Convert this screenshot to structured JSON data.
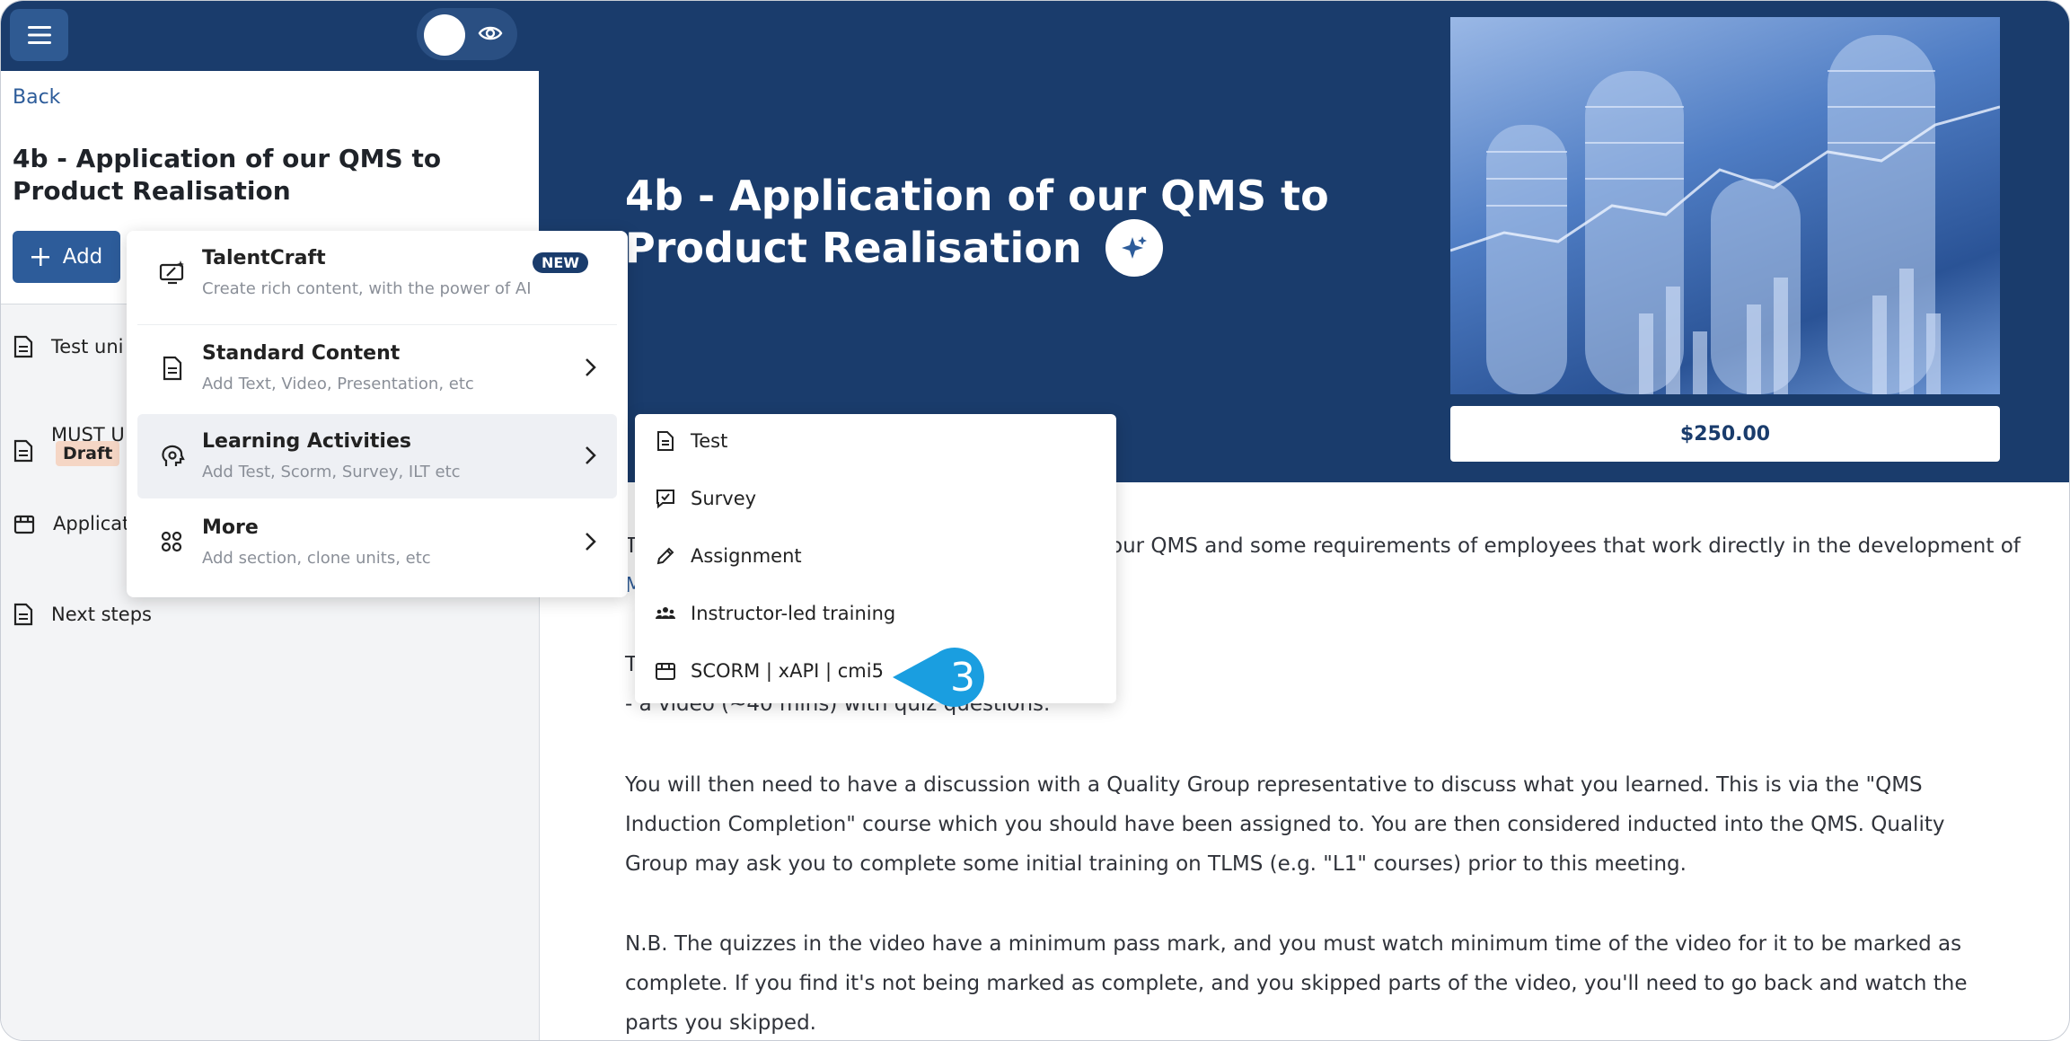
{
  "sidebar": {
    "back_label": "Back",
    "course_title": "4b - Application of our QMS to Product Realisation",
    "add_label": "Add",
    "units": [
      {
        "label": "Test uni",
        "icon": "document-icon"
      },
      {
        "label": "MUST U",
        "icon": "document-icon",
        "badge": "Draft"
      },
      {
        "label": "Applicat",
        "icon": "package-icon"
      },
      {
        "label": "Next steps",
        "icon": "document-icon"
      }
    ]
  },
  "add_menu": {
    "items": [
      {
        "title": "TalentCraft",
        "subtitle": "Create rich content, with the power of AI",
        "badge": "NEW",
        "icon": "ai-monitor-icon"
      },
      {
        "title": "Standard Content",
        "subtitle": "Add Text, Video, Presentation, etc",
        "icon": "document-icon"
      },
      {
        "title": "Learning Activities",
        "subtitle": "Add Test, Scorm, Survey, ILT etc",
        "icon": "brain-gear-icon"
      },
      {
        "title": "More",
        "subtitle": "Add section, clone units, etc",
        "icon": "grid-icon"
      }
    ]
  },
  "activity_menu": {
    "items": [
      {
        "label": "Test",
        "icon": "document-icon"
      },
      {
        "label": "Survey",
        "icon": "survey-icon"
      },
      {
        "label": "Assignment",
        "icon": "pencil-icon"
      },
      {
        "label": "Instructor-led training",
        "icon": "group-icon"
      },
      {
        "label": "SCORM | xAPI | cmi5",
        "icon": "package-icon"
      }
    ]
  },
  "main": {
    "hero_title": "4b - Application of our QMS to Product Realisation",
    "price": "$250.00",
    "para1_left": "T",
    "para1_right": "our QMS and some requirements of employees that work directly in the development of",
    "para1_line2_start": "M",
    "para2_start": "T",
    "para2_line2": "- a video (~40 mins) with quiz questions.",
    "para3": "You will then need to have a discussion with a Quality Group representative to discuss what you learned. This is via the \"QMS Induction Completion\" course which you should have been assigned to. You are then considered inducted into the QMS. Quality Group may ask you to complete some initial training on TLMS (e.g. \"L1\" courses) prior to this meeting.",
    "para4": "N.B. The quizzes in the video have a minimum pass mark, and you must watch minimum time of the video for it to be marked as complete. If you find it's not being marked as complete, and you skipped parts of the video, you'll need to go back and watch the parts you skipped."
  },
  "callout": {
    "number": "3",
    "color": "#1a9ee0"
  },
  "colors": {
    "navy": "#1a3c6c",
    "accent": "#2d5c9a",
    "draft": "#f5d6c5"
  }
}
